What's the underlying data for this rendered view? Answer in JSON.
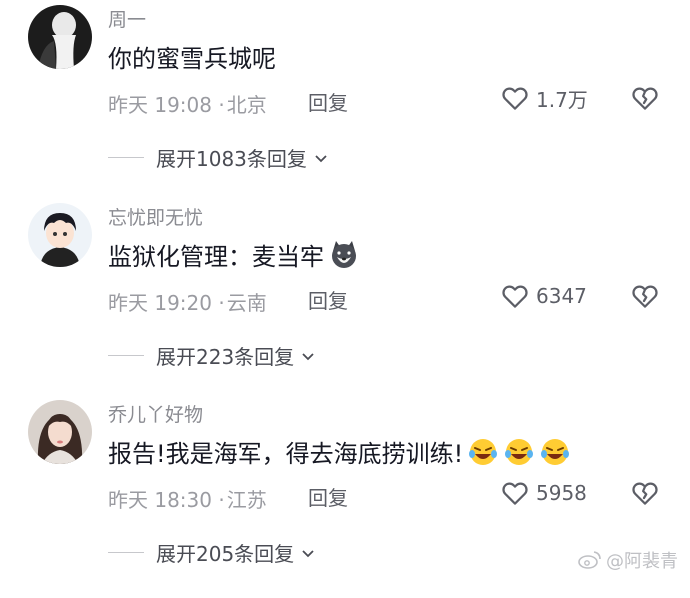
{
  "comments": [
    {
      "username": "周一",
      "text": "你的蜜雪兵城呢",
      "time": "昨天 19:08 · ",
      "location": "北京",
      "reply_label": "回复",
      "likes": "1.7万",
      "expand_label": "展开1083条回复",
      "avatar": "dark-figure"
    },
    {
      "username": "忘忧即无忧",
      "text": "监狱化管理：麦当牢",
      "emojis": [
        "dog-face-emoji"
      ],
      "time": "昨天 19:20 · ",
      "location": "云南",
      "reply_label": "回复",
      "likes": "6347",
      "expand_label": "展开223条回复",
      "avatar": "anime-boy"
    },
    {
      "username": "乔儿丫好物",
      "text": "报告!我是海军，得去海底捞训练!",
      "emojis": [
        "laughing-emoji",
        "laughing-emoji",
        "laughing-emoji"
      ],
      "time": "昨天 18:30 · ",
      "location": "江苏",
      "reply_label": "回复",
      "likes": "5958",
      "expand_label": "展开205条回复",
      "avatar": "girl-portrait"
    }
  ],
  "watermark": "@阿裴青",
  "colors": {
    "text": "#161823",
    "secondary": "#9a9ba1",
    "username": "#8a8b91"
  }
}
